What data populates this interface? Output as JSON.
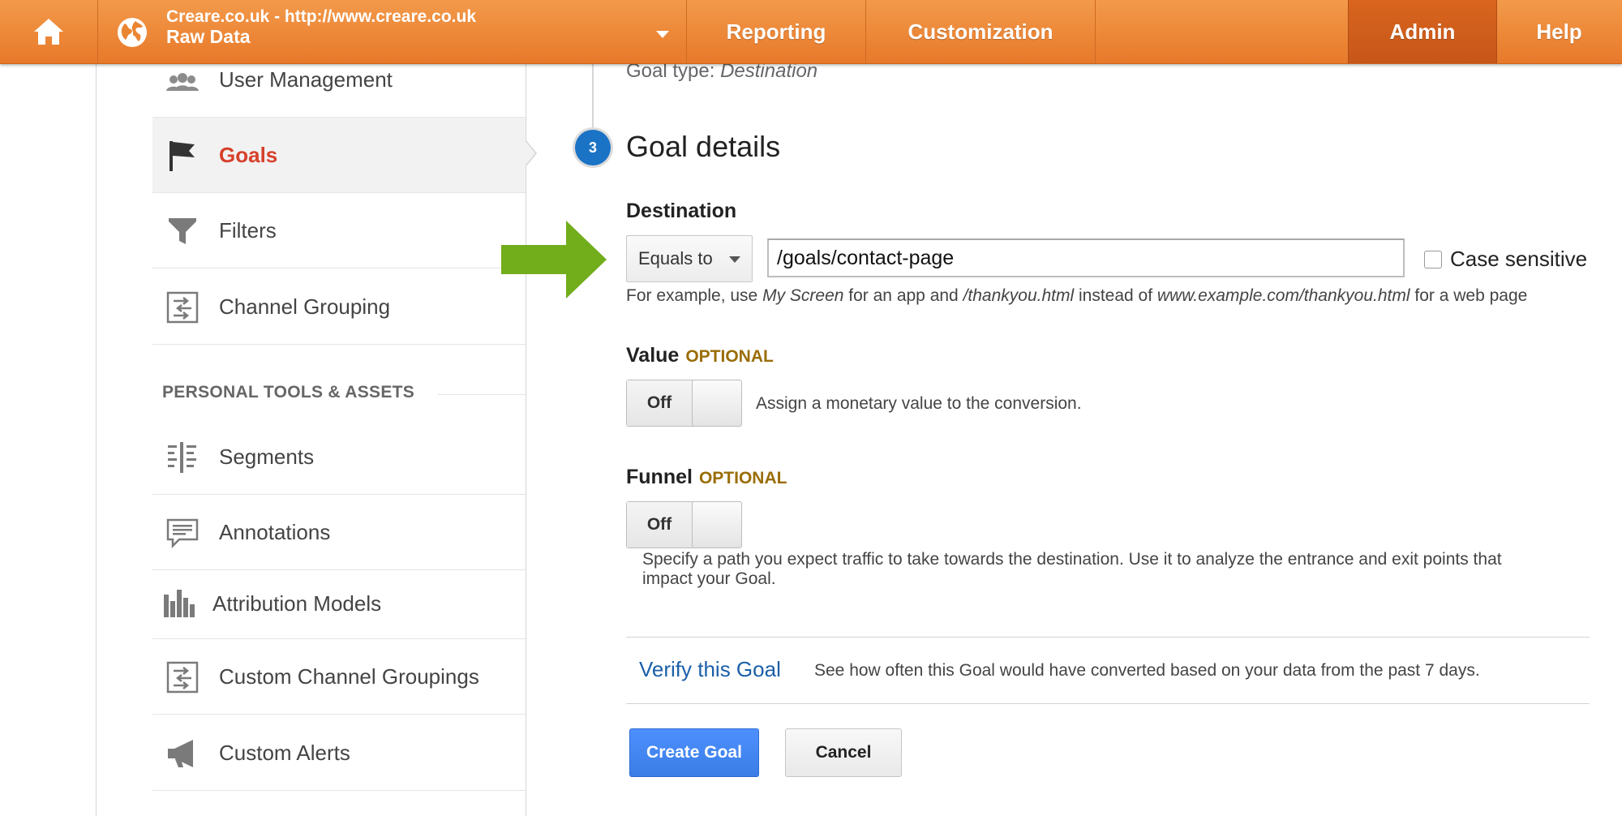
{
  "header": {
    "account_line1": "Creare.co.uk - http://www.creare.co.uk",
    "account_line2": "Raw Data",
    "tabs": [
      "Reporting",
      "Customization",
      "Admin",
      "Help"
    ],
    "active_tab": "Admin"
  },
  "sidebar": {
    "items_top": [
      {
        "label": "User Management",
        "icon": "users-icon"
      },
      {
        "label": "Goals",
        "icon": "flag-icon",
        "active": true
      },
      {
        "label": "Filters",
        "icon": "filter-icon"
      },
      {
        "label": "Channel Grouping",
        "icon": "channel-grouping-icon"
      }
    ],
    "section_title": "PERSONAL TOOLS & ASSETS",
    "items_bottom": [
      {
        "label": "Segments",
        "icon": "segments-icon"
      },
      {
        "label": "Annotations",
        "icon": "annotations-icon"
      },
      {
        "label": "Attribution Models",
        "icon": "bar-chart-icon"
      },
      {
        "label": "Custom Channel Groupings",
        "icon": "channel-grouping-icon"
      },
      {
        "label": "Custom Alerts",
        "icon": "megaphone-icon"
      }
    ]
  },
  "main": {
    "goal_type_label": "Goal type:",
    "goal_type_value": "Destination",
    "step_number": "3",
    "step_title": "Goal details",
    "destination_label": "Destination",
    "match_type": "Equals to",
    "destination_value": "/goals/contact-page",
    "case_sensitive_label": "Case sensitive",
    "case_sensitive_checked": false,
    "example": {
      "p1": "For example, use ",
      "e1": "My Screen",
      "p2": " for an app and ",
      "e2": "/thankyou.html",
      "p3": " instead of ",
      "e3": "www.example.com/thankyou.html",
      "p4": " for a web page"
    },
    "value_label": "Value",
    "value_optional": "OPTIONAL",
    "value_toggle": "Off",
    "value_hint": "Assign a monetary value to the conversion.",
    "funnel_label": "Funnel",
    "funnel_optional": "OPTIONAL",
    "funnel_toggle": "Off",
    "funnel_hint_line1": "Specify a path you expect traffic to take towards the destination. Use it to analyze the entrance and exit points that",
    "funnel_hint_line2": "impact your Goal.",
    "verify_link": "Verify this Goal",
    "verify_text": "See how often this Goal would have converted based on your data from the past 7 days.",
    "create_button": "Create Goal",
    "cancel_button": "Cancel"
  },
  "colors": {
    "header_orange": "#ec8532",
    "active_red": "#d7402b",
    "optional_gold": "#9a6d07",
    "link_blue": "#1b5fa8",
    "primary_blue": "#4d90fe",
    "arrow_green": "#72ad1c"
  }
}
